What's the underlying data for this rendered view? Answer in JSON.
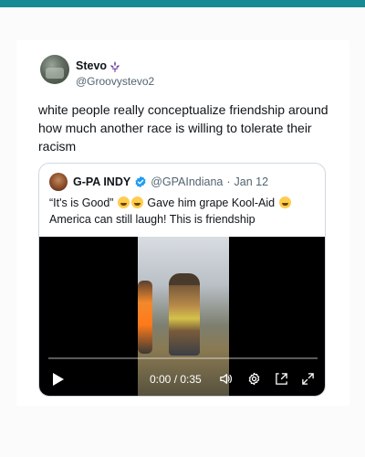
{
  "tweet": {
    "display_name": "Stevo",
    "handle": "@Groovystevo2",
    "text": "white people really conceptualize friendship around how much another race is willing to tolerate their racism"
  },
  "quote": {
    "display_name": "G-PA INDY",
    "handle": "@GPAIndiana",
    "separator": "·",
    "date": "Jan 12",
    "text_part1": "“It's is Good” ",
    "text_part2": " Gave him grape Kool-Aid ",
    "text_part3": " America can still laugh! This is friendship"
  },
  "video": {
    "time": "0:00 / 0:35",
    "progress": 0
  },
  "colors": {
    "top_bar": "#188a93",
    "verified": "#1d9bf0",
    "fleur": "#6b3fa0"
  },
  "icons": [
    "fleur-de-lis-icon",
    "verified-badge-icon",
    "laughing-emoji-icon",
    "play-icon",
    "volume-icon",
    "settings-icon",
    "picture-in-picture-icon",
    "fullscreen-icon"
  ]
}
